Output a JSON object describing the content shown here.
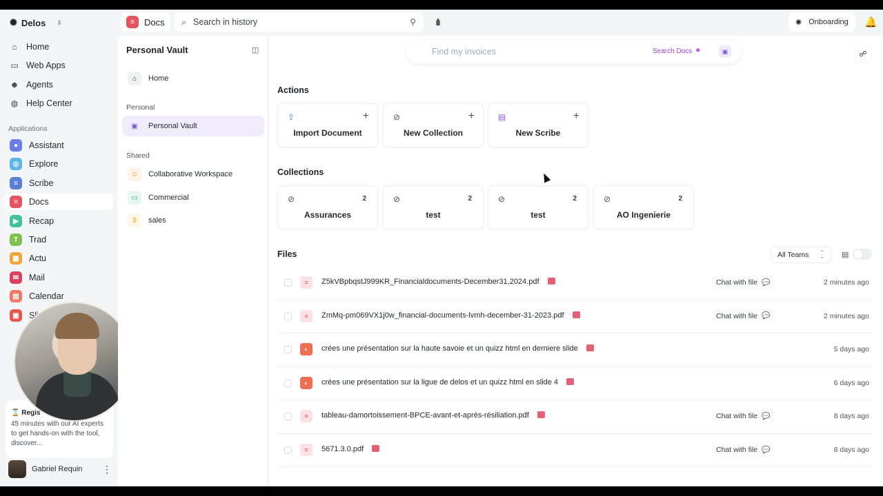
{
  "brand": {
    "name": "Delos"
  },
  "sidebar": {
    "items": [
      {
        "label": "Home",
        "icon": "home-icon"
      },
      {
        "label": "Web Apps",
        "icon": "window-icon"
      },
      {
        "label": "Agents",
        "icon": "robot-icon"
      },
      {
        "label": "Help Center",
        "icon": "globe-icon"
      }
    ],
    "apps_label": "Applications",
    "apps": [
      {
        "label": "Assistant",
        "color": "#6b7ee8"
      },
      {
        "label": "Explore",
        "color": "#5bb6e8"
      },
      {
        "label": "Scribe",
        "color": "#5b7fd8"
      },
      {
        "label": "Docs",
        "color": "#e4555f"
      },
      {
        "label": "Recap",
        "color": "#3fc39b"
      },
      {
        "label": "Trad",
        "color": "#7fc24f"
      },
      {
        "label": "Actu",
        "color": "#f2a33a"
      },
      {
        "label": "Mail",
        "color": "#d8415f"
      },
      {
        "label": "Calendar",
        "color": "#ef7a63"
      },
      {
        "label": "Sli",
        "color": "#e8554f"
      }
    ],
    "promo_title": "Regis",
    "promo_text": "45 minutes with our AI experts to get hands-on with the tool, discover...",
    "user_name": "Gabriel Requin"
  },
  "topbar": {
    "app_label": "Docs",
    "search_placeholder": "Search in history",
    "workspace_label": "Onboarding"
  },
  "panel": {
    "title": "Personal Vault",
    "home_label": "Home",
    "personal_label": "Personal",
    "personal_items": [
      {
        "label": "Personal Vault"
      }
    ],
    "shared_label": "Shared",
    "shared_items": [
      {
        "label": "Collaborative Workspace"
      },
      {
        "label": "Commercial"
      },
      {
        "label": "sales"
      }
    ]
  },
  "main": {
    "find_placeholder": "Find my invoices",
    "search_docs_label": "Search Docs",
    "actions_heading": "Actions",
    "actions": [
      {
        "label": "Import Document"
      },
      {
        "label": "New Collection"
      },
      {
        "label": "New Scribe"
      }
    ],
    "collections_heading": "Collections",
    "collections": [
      {
        "label": "Assurances",
        "count": "2"
      },
      {
        "label": "test",
        "count": "2"
      },
      {
        "label": "test",
        "count": "2"
      },
      {
        "label": "AO Ingenierie",
        "count": "2"
      }
    ],
    "files_heading": "Files",
    "teams_filter": "All Teams",
    "chat_label": "Chat with file",
    "files": [
      {
        "name": "Z5kVBpbqstJ999KR_Financialdocuments-December31,2024.pdf",
        "type": "pdf",
        "chat": true,
        "time": "2 minutes ago"
      },
      {
        "name": "ZmMq-pm069VX1j0w_financial-documents-lvmh-december-31-2023.pdf",
        "type": "pdf",
        "chat": true,
        "time": "2 minutes ago"
      },
      {
        "name": "crées une présentation sur la haute savoie et un quizz html en derniere slide",
        "type": "ppt",
        "chat": false,
        "time": "5 days ago"
      },
      {
        "name": "crées une présentation sur la ligue de delos et un quizz html en slide 4",
        "type": "ppt",
        "chat": false,
        "time": "6 days ago"
      },
      {
        "name": "tableau-damortoissement-BPCE-avant-et-après-résiliation.pdf",
        "type": "pdf",
        "chat": true,
        "time": "8 days ago"
      },
      {
        "name": "5671.3.0.pdf",
        "type": "pdf",
        "chat": true,
        "time": "8 days ago"
      }
    ]
  }
}
